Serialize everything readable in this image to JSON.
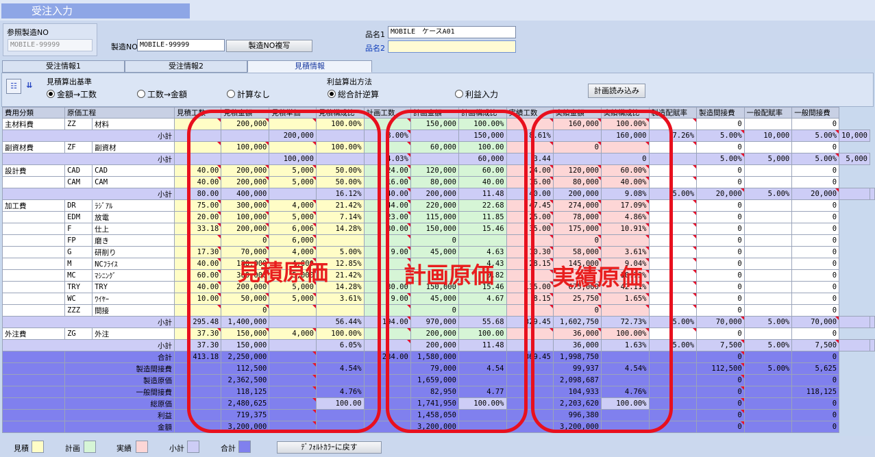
{
  "window_title": "受注入力",
  "ref": {
    "label": "参照製造NO",
    "value": "MOBILE-99999"
  },
  "seizo": {
    "label": "製造NO",
    "value": "MOBILE-99999",
    "copy_button": "製造NO複写"
  },
  "hinmei1": {
    "label": "品名1",
    "value": "MOBILE　ケースA01"
  },
  "hinmei2": {
    "label": "品名2",
    "value": ""
  },
  "tabs": [
    "受注情報1",
    "受注情報2",
    "見積情報"
  ],
  "estimate_basis": {
    "label": "見積算出基準",
    "options": [
      "金額→工数",
      "工数→金額",
      "計算なし"
    ]
  },
  "profit_method": {
    "label": "利益算出方法",
    "options": [
      "総合計逆算",
      "利益入力"
    ]
  },
  "load_plan_button": "計画読み込み",
  "headers": [
    "費用分類",
    "原価工程",
    "見積工数",
    "見積金額",
    "見積単価",
    "見積構成比",
    "計画工数",
    "計画金額",
    "計画構成比",
    "実績工数",
    "実績金額",
    "実績構成比",
    "製造配賦率",
    "製造間接費",
    "一般配賦率",
    "一般間接費"
  ],
  "rows": [
    {
      "k": "d",
      "c": [
        "主材料費",
        "ZZ",
        "材料",
        "",
        "200,000",
        "",
        "100.00%",
        "",
        "150,000",
        "100.00%",
        "",
        "160,000",
        "100.00%",
        "",
        "0",
        "",
        "0"
      ]
    },
    {
      "k": "s",
      "c": [
        "小計",
        "",
        "",
        "200,000",
        "",
        "8.00%",
        "",
        "150,000",
        "8.61%",
        "",
        "160,000",
        "7.26%",
        "5.00%",
        "10,000",
        "5.00%",
        "10,000"
      ]
    },
    {
      "k": "d",
      "c": [
        "副資材費",
        "ZF",
        "副資材",
        "",
        "100,000",
        "",
        "100.00%",
        "",
        "60,000",
        "100.00",
        "",
        "0",
        "",
        "",
        "0",
        "",
        "0"
      ]
    },
    {
      "k": "s",
      "c": [
        "小計",
        "",
        "",
        "100,000",
        "",
        "4.03%",
        "",
        "60,000",
        "3.44",
        "",
        "0",
        "",
        "5.00%",
        "5,000",
        "5.00%",
        "5,000"
      ]
    },
    {
      "k": "d",
      "c": [
        "設計費",
        "CAD",
        "CAD",
        "40.00",
        "200,000",
        "5,000",
        "50.00%",
        "24.00",
        "120,000",
        "60.00",
        "24.00",
        "120,000",
        "60.00%",
        "",
        "0",
        "",
        "0"
      ]
    },
    {
      "k": "d",
      "c": [
        "",
        "CAM",
        "CAM",
        "40.00",
        "200,000",
        "5,000",
        "50.00%",
        "16.00",
        "80,000",
        "40.00",
        "16.00",
        "80,000",
        "40.00%",
        "",
        "0",
        "",
        "0"
      ]
    },
    {
      "k": "s",
      "c": [
        "小計",
        "80.00",
        "400,000",
        "",
        "16.12%",
        "40.00",
        "200,000",
        "11.48",
        "40.00",
        "200,000",
        "9.08%",
        "5.00%",
        "20,000",
        "5.00%",
        "20,000"
      ]
    },
    {
      "k": "d",
      "c": [
        "加工費",
        "DR",
        "ﾗｼﾞｱﾙ",
        "75.00",
        "300,000",
        "4,000",
        "21.42%",
        "44.00",
        "220,000",
        "22.68",
        "47.45",
        "274,000",
        "17.09%",
        "",
        "0",
        "",
        "0"
      ]
    },
    {
      "k": "d",
      "c": [
        "",
        "EDM",
        "放電",
        "20.00",
        "100,000",
        "5,000",
        "7.14%",
        "23.00",
        "115,000",
        "11.85",
        "25.00",
        "78,000",
        "4.86%",
        "",
        "0",
        "",
        "0"
      ]
    },
    {
      "k": "d",
      "c": [
        "",
        "F",
        "仕上",
        "33.18",
        "200,000",
        "6,006",
        "14.28%",
        "30.00",
        "150,000",
        "15.46",
        "35.00",
        "175,000",
        "10.91%",
        "",
        "0",
        "",
        "0"
      ]
    },
    {
      "k": "d",
      "c": [
        "",
        "FP",
        "磨き",
        "",
        "0",
        "6,000",
        "",
        "",
        "0",
        "",
        "",
        "0",
        "",
        "",
        "0",
        "",
        "0"
      ]
    },
    {
      "k": "d",
      "c": [
        "",
        "G",
        "研削り",
        "17.30",
        "70,000",
        "4,000",
        "5.00%",
        "9.00",
        "45,000",
        "4.63",
        "10.30",
        "58,000",
        "3.61%",
        "",
        "0",
        "",
        "0"
      ]
    },
    {
      "k": "d",
      "c": [
        "",
        "M",
        "NCﾌﾗｲｽ",
        "40.00",
        "180,000",
        "4,000",
        "12.85%",
        "",
        "",
        "4.43",
        "28.15",
        "145,000",
        "9.04%",
        "",
        "0",
        "",
        "0"
      ]
    },
    {
      "k": "d",
      "c": [
        "",
        "MC",
        "ﾏｼﾆﾝｸﾞ",
        "60.00",
        "300,000",
        "5,000",
        "21.42%",
        "",
        "",
        "0.82",
        "",
        "",
        "10.73%",
        "",
        "0",
        "",
        "0"
      ]
    },
    {
      "k": "d",
      "c": [
        "",
        "TRY",
        "TRY",
        "40.00",
        "200,000",
        "5,000",
        "14.28%",
        "30.00",
        "150,000",
        "15.46",
        "135.00",
        "675,000",
        "42.11%",
        "",
        "0",
        "",
        "0"
      ]
    },
    {
      "k": "d",
      "c": [
        "",
        "WC",
        "ﾜｲﾔｰ",
        "10.00",
        "50,000",
        "5,000",
        "3.61%",
        "9.00",
        "45,000",
        "4.67",
        "8.15",
        "25,750",
        "1.65%",
        "",
        "0",
        "",
        "0"
      ]
    },
    {
      "k": "d",
      "c": [
        "",
        "ZZZ",
        "間接",
        "",
        "0",
        "",
        "",
        "",
        "0",
        "",
        "",
        "0",
        "",
        "",
        "0",
        "",
        "0"
      ]
    },
    {
      "k": "s",
      "c": [
        "小計",
        "295.48",
        "1,400,000",
        "",
        "56.44%",
        "194.00",
        "970,000",
        "55.68",
        "329.45",
        "1,602,750",
        "72.73%",
        "5.00%",
        "70,000",
        "5.00%",
        "70,000"
      ]
    },
    {
      "k": "d",
      "c": [
        "外注費",
        "ZG",
        "外注",
        "37.30",
        "150,000",
        "4,000",
        "100.00%",
        "",
        "200,000",
        "100.00",
        "",
        "36,000",
        "100.00%",
        "",
        "0",
        "",
        "0"
      ]
    },
    {
      "k": "s",
      "c": [
        "小計",
        "37.30",
        "150,000",
        "",
        "6.05%",
        "",
        "200,000",
        "11.48",
        "",
        "36,000",
        "1.63%",
        "5.00%",
        "7,500",
        "5.00%",
        "7,500"
      ]
    },
    {
      "k": "t",
      "c": [
        "合計",
        "413.18",
        "2,250,000",
        "",
        "",
        "234.00",
        "1,580,000",
        "",
        "369.45",
        "1,998,750",
        "",
        "",
        "0",
        "",
        "0"
      ]
    },
    {
      "k": "t",
      "c": [
        "製造間接費",
        "",
        "112,500",
        "",
        "4.54%",
        "",
        "79,000",
        "4.54",
        "",
        "99,937",
        "4.54%",
        "",
        "112,500",
        "5.00%",
        "5,625"
      ]
    },
    {
      "k": "t",
      "c": [
        "製造原価",
        "",
        "2,362,500",
        "",
        "",
        "",
        "1,659,000",
        "",
        "",
        "2,098,687",
        "",
        "",
        "0",
        "",
        "0"
      ]
    },
    {
      "k": "t",
      "c": [
        "一般間接費",
        "",
        "118,125",
        "",
        "4.76%",
        "",
        "82,950",
        "4.77",
        "",
        "104,933",
        "4.76%",
        "",
        "0",
        "",
        "118,125"
      ]
    },
    {
      "k": "t",
      "c": [
        "総原価",
        "",
        "2,480,625",
        "",
        "100.00",
        "",
        "1,741,950",
        "100.00%",
        "",
        "2,203,620",
        "100.00%",
        "",
        "0",
        "",
        "0"
      ]
    },
    {
      "k": "t",
      "c": [
        "利益",
        "",
        "719,375",
        "",
        "",
        "",
        "1,458,050",
        "",
        "",
        "996,380",
        "",
        "",
        "0",
        "",
        "0"
      ]
    },
    {
      "k": "t",
      "c": [
        "金額",
        "",
        "3,200,000",
        "",
        "",
        "",
        "3,200,000",
        "",
        "",
        "3,200,000",
        "",
        "",
        "0",
        "",
        "0"
      ]
    }
  ],
  "overlays": [
    "見積原価",
    "計画原価",
    "実績原価"
  ],
  "legend": {
    "items": [
      "見積",
      "計画",
      "実績",
      "小計",
      "合計"
    ],
    "colors": [
      "#fffdc6",
      "#d6f5d6",
      "#fdd6d6",
      "#cdcdf6",
      "#8080ee"
    ],
    "reset_button": "ﾃﾞﾌｫﾙﾄｶﾗｰに戻す"
  }
}
